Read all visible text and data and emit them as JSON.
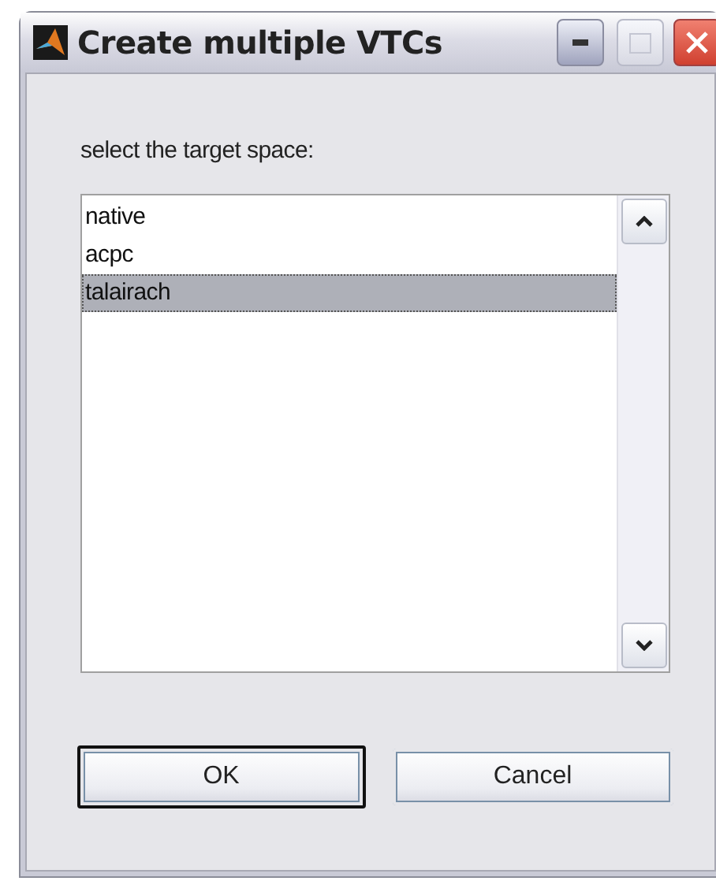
{
  "window": {
    "title": "Create multiple VTCs"
  },
  "prompt": "select the target space:",
  "list": {
    "items": [
      {
        "label": "native",
        "selected": false
      },
      {
        "label": "acpc",
        "selected": false
      },
      {
        "label": "talairach",
        "selected": true
      }
    ]
  },
  "buttons": [
    {
      "label": "OK",
      "focused": true
    },
    {
      "label": "Cancel",
      "focused": false
    }
  ]
}
